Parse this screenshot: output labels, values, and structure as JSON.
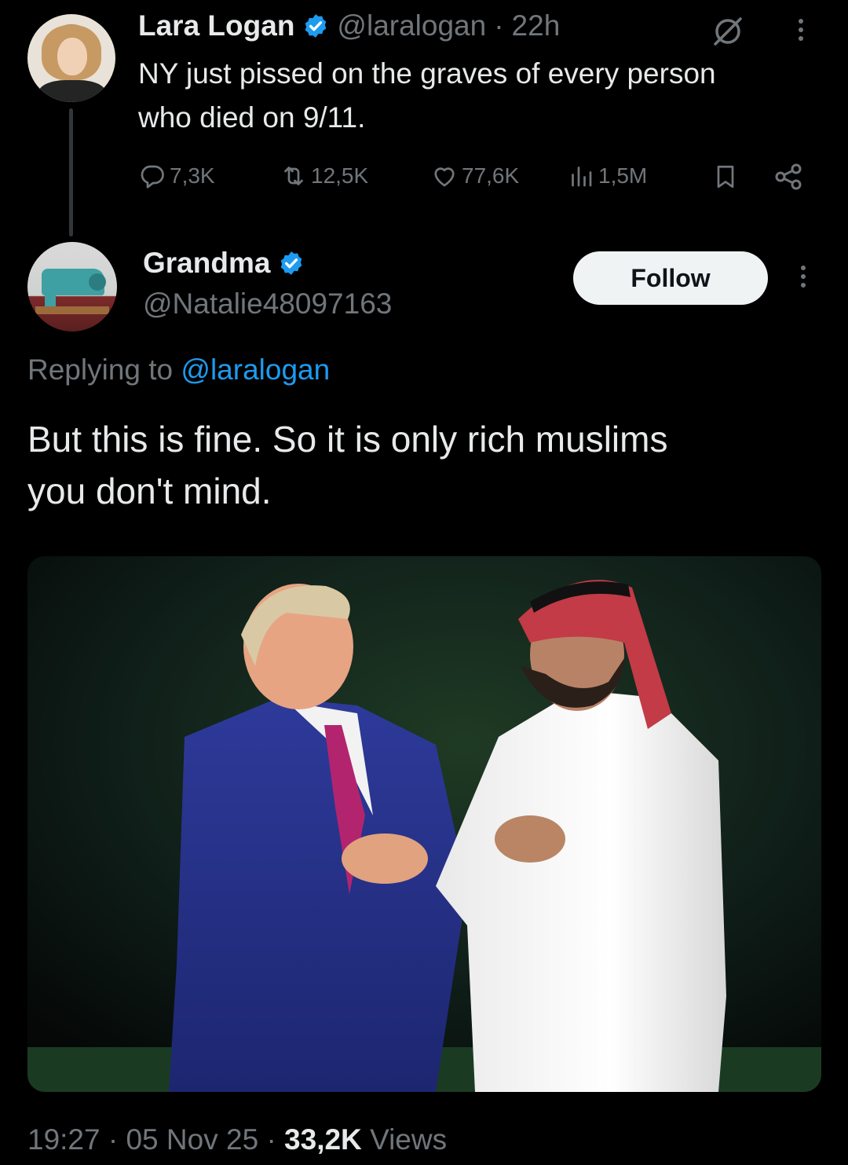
{
  "parent_tweet": {
    "author_name": "Lara Logan",
    "handle": "@laralogan",
    "separator": "·",
    "time": "22h",
    "text_line1": "NY just pissed on the graves of every person",
    "text_line2": "who died on 9/11.",
    "stats": {
      "replies": "7,3K",
      "reposts": "12,5K",
      "likes": "77,6K",
      "views": "1,5M"
    },
    "icons": [
      "grok-icon",
      "more-icon",
      "reply-icon",
      "repost-icon",
      "like-icon",
      "views-icon",
      "bookmark-icon",
      "share-icon"
    ]
  },
  "reply_tweet": {
    "author_name": "Grandma",
    "handle": "@Natalie48097163",
    "follow_label": "Follow",
    "replying_prefix": "Replying to",
    "replying_handle": "@laralogan",
    "text_line1": "But this is fine. So it is only rich muslims",
    "text_line2": "you don't mind."
  },
  "meta": {
    "time": "19:27",
    "sep1": "·",
    "date": "05 Nov 25",
    "sep2": "·",
    "views_count": "33,2K",
    "views_label": "Views"
  },
  "colors": {
    "background": "#000000",
    "text_primary": "#e7e9ea",
    "text_muted": "#71767b",
    "accent_blue": "#1d9bf0",
    "follow_bg": "#eff3f4"
  }
}
